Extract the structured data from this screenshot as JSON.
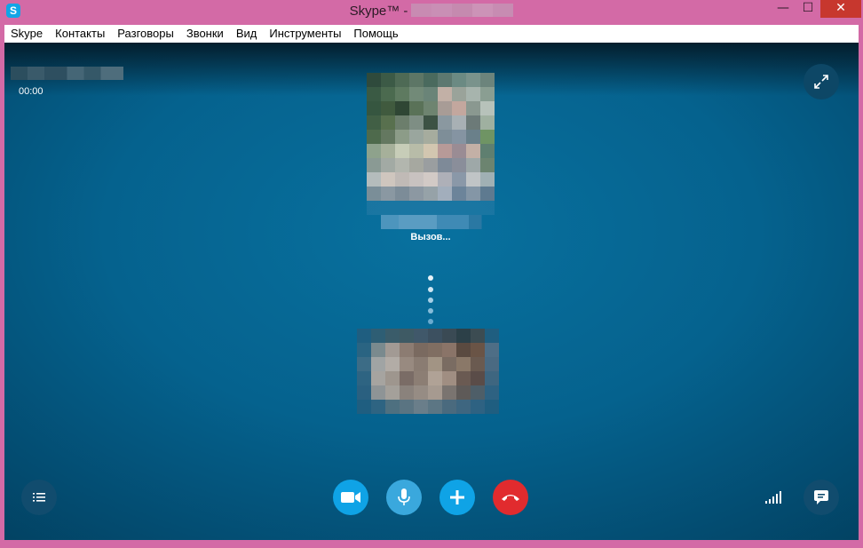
{
  "window": {
    "title": "Skype™ -",
    "app_icon_letter": "S",
    "minimize_glyph": "—",
    "maximize_glyph": "☐",
    "close_glyph": "✕"
  },
  "menu": [
    "Skype",
    "Контакты",
    "Разговоры",
    "Звонки",
    "Вид",
    "Инструменты",
    "Помощь"
  ],
  "call": {
    "timer": "00:00",
    "status": "Вызов..."
  },
  "icons": {
    "fullscreen": "expand-icon",
    "video": "video-camera-icon",
    "mic": "microphone-icon",
    "add": "plus-icon",
    "end": "hang-up-icon",
    "list": "call-list-icon",
    "signal": "signal-strength-icon",
    "chat": "chat-bubble-icon"
  },
  "colors": {
    "frame": "#d36aa6",
    "stage": "#05628e",
    "accent": "#0fa3e6",
    "end_call": "#e12b2e"
  }
}
